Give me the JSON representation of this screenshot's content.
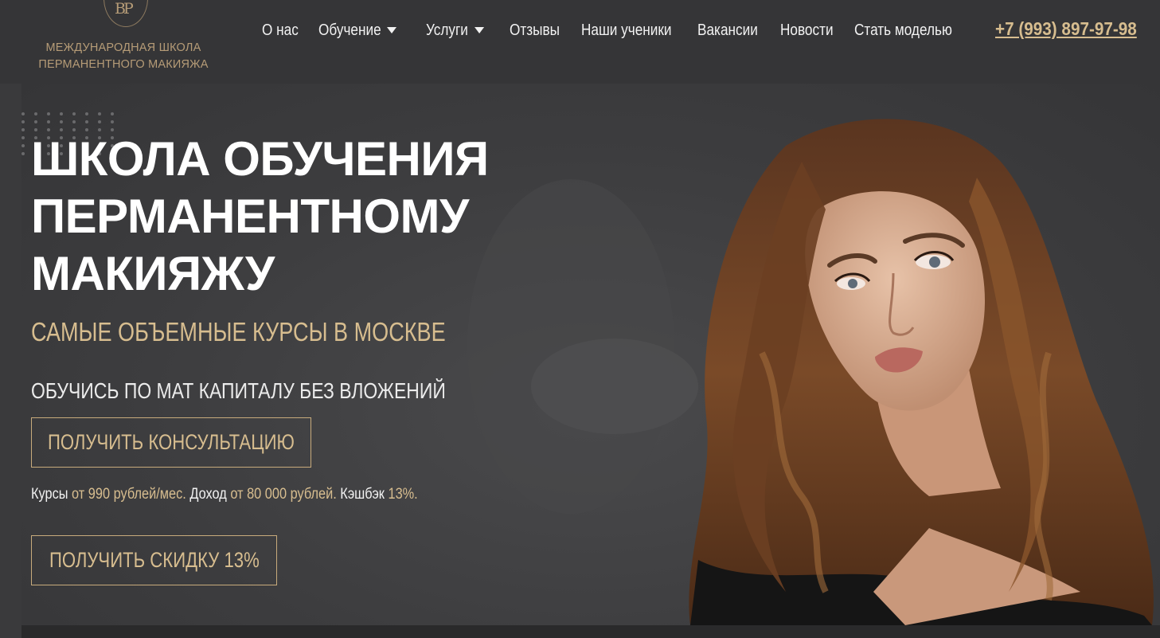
{
  "logo": {
    "letters": "BP",
    "line1": "МЕЖДУНАРОДНАЯ ШКОЛА",
    "line2": "ПЕРМАНЕНТНОГО МАКИЯЖА"
  },
  "nav": {
    "items": [
      {
        "label": "О нас"
      },
      {
        "label": "Обучение"
      },
      {
        "label": "Услуги"
      },
      {
        "label": "Отзывы"
      },
      {
        "label": "Наши ученики"
      },
      {
        "label": "Вакансии"
      },
      {
        "label": "Новости"
      },
      {
        "label": "Стать моделью"
      }
    ],
    "phone": "+7 (993) 897-97-98"
  },
  "hero": {
    "title_line1": "ШКОЛА ОБУЧЕНИЯ",
    "title_line2": "ПЕРМАНЕНТНОМУ",
    "title_line3": "МАКИЯЖУ",
    "subtitle": "САМЫЕ ОБЪЕМНЫЕ КУРСЫ В МОСКВЕ",
    "tagline": "ОБУЧИСЬ ПО МАТ КАПИТАЛУ БЕЗ ВЛОЖЕНИЙ",
    "consult_button": "ПОЛУЧИТЬ КОНСУЛЬТАЦИЮ",
    "discount_button": "ПОЛУЧИТЬ СКИДКУ 13%",
    "prices": {
      "courses_label": "Курсы",
      "courses_value": "от 990 рублей/мес.",
      "income_label": "Доход",
      "income_value": "от 80 000 рублей.",
      "cashback_label": "Кэшбэк",
      "cashback_value": "13%."
    }
  },
  "colors": {
    "accent_gold": "#d7bd8f",
    "header_bg": "#353537",
    "hero_bg": "#3d3d3f"
  }
}
